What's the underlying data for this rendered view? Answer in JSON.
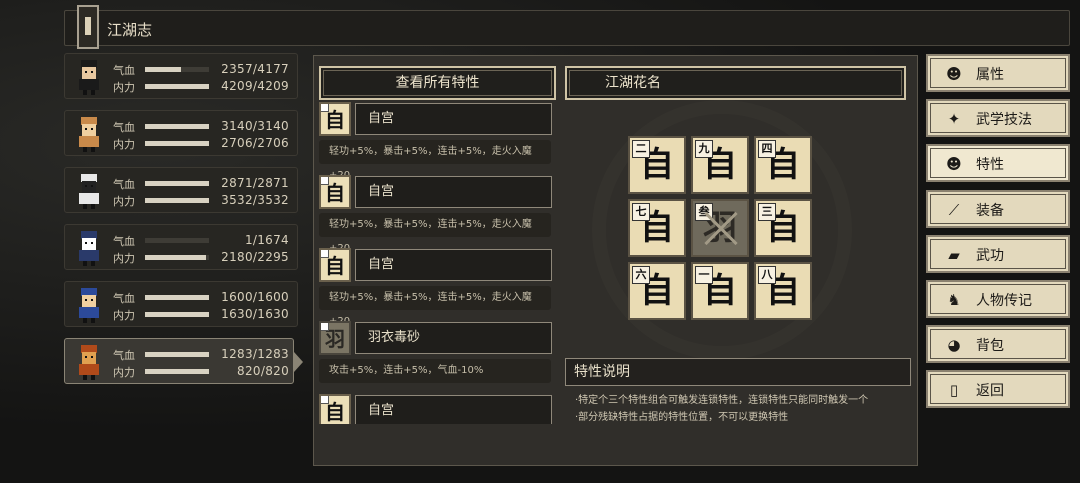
{
  "header": {
    "title": "江湖志"
  },
  "characters": [
    {
      "hp_label": "气血",
      "mp_label": "内力",
      "hp": "2357/4177",
      "mp": "4209/4209",
      "hp_frac": 0.56,
      "mp_frac": 1.0
    },
    {
      "hp_label": "气血",
      "mp_label": "内力",
      "hp": "3140/3140",
      "mp": "2706/2706",
      "hp_frac": 1.0,
      "mp_frac": 1.0
    },
    {
      "hp_label": "气血",
      "mp_label": "内力",
      "hp": "2871/2871",
      "mp": "3532/3532",
      "hp_frac": 1.0,
      "mp_frac": 1.0
    },
    {
      "hp_label": "气血",
      "mp_label": "内力",
      "hp": "1/1674",
      "mp": "2180/2295",
      "hp_frac": 0.0,
      "mp_frac": 0.95
    },
    {
      "hp_label": "气血",
      "mp_label": "内力",
      "hp": "1600/1600",
      "mp": "1630/1630",
      "hp_frac": 1.0,
      "mp_frac": 1.0
    },
    {
      "hp_label": "气血",
      "mp_label": "内力",
      "hp": "1283/1283",
      "mp": "820/820",
      "hp_frac": 1.0,
      "mp_frac": 1.0
    }
  ],
  "panel": {
    "view_all_button": "查看所有特性",
    "nickname_button": "江湖花名",
    "traits": [
      {
        "glyph": "自",
        "name": "自宫",
        "desc": "轻功+5%，暴击+5%，连击+5%，走火入魔+20"
      },
      {
        "glyph": "自",
        "name": "自宫",
        "desc": "轻功+5%，暴击+5%，连击+5%，走火入魔+20"
      },
      {
        "glyph": "自",
        "name": "自宫",
        "desc": "轻功+5%，暴击+5%，连击+5%，走火入魔+20"
      },
      {
        "glyph": "羽",
        "name": "羽衣毒砂",
        "desc": "攻击+5%，连击+5%，气血-10%"
      },
      {
        "glyph": "自",
        "name": "自宫",
        "desc": ""
      }
    ],
    "grid": [
      {
        "num": "二",
        "glyph": "自"
      },
      {
        "num": "九",
        "glyph": "自"
      },
      {
        "num": "四",
        "glyph": "自"
      },
      {
        "num": "七",
        "glyph": "自"
      },
      {
        "num": "叁",
        "glyph": "羽"
      },
      {
        "num": "三",
        "glyph": "自"
      },
      {
        "num": "六",
        "glyph": "自"
      },
      {
        "num": "一",
        "glyph": "自"
      },
      {
        "num": "八",
        "glyph": "自"
      }
    ],
    "description_title": "特性说明",
    "description_lines": [
      "·特定个三个特性组合可触发连锁特性，连锁特性只能同时触发一个",
      "·部分残缺特性占据的特性位置，不可以更换特性"
    ]
  },
  "menu": [
    {
      "label": "属性",
      "icon": "person-icon"
    },
    {
      "label": "武学技法",
      "icon": "skill-icon"
    },
    {
      "label": "特性",
      "icon": "trait-icon"
    },
    {
      "label": "装备",
      "icon": "sword-icon"
    },
    {
      "label": "武功",
      "icon": "scroll-icon"
    },
    {
      "label": "人物传记",
      "icon": "biography-icon"
    },
    {
      "label": "背包",
      "icon": "bag-icon"
    },
    {
      "label": "返回",
      "icon": "door-icon"
    }
  ]
}
